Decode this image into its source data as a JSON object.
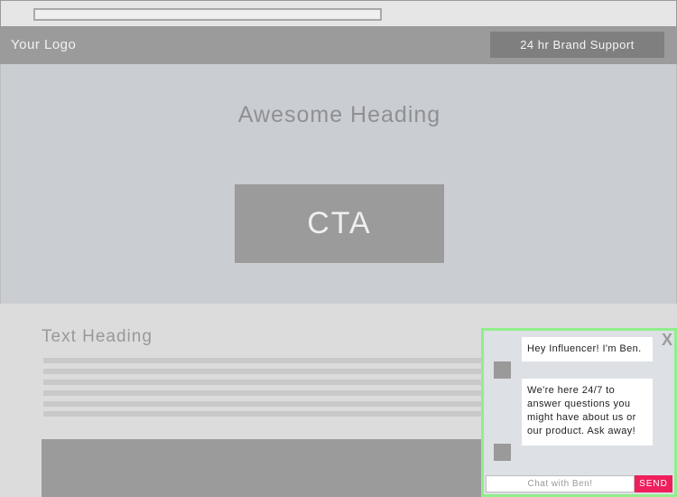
{
  "header": {
    "logo": "Your Logo",
    "support_button": "24 hr Brand Support"
  },
  "hero": {
    "heading": "Awesome Heading",
    "cta_label": "CTA"
  },
  "content": {
    "text_heading": "Text Heading"
  },
  "chat": {
    "close_label": "X",
    "messages": [
      "Hey Influencer! I'm Ben.",
      "We're here 24/7 to answer questions you might have about us or our product. Ask away!"
    ],
    "input_placeholder": "Chat with Ben!",
    "send_label": "SEND"
  },
  "colors": {
    "chat_border": "#8fef8a",
    "send_button": "#ef1f5c"
  }
}
